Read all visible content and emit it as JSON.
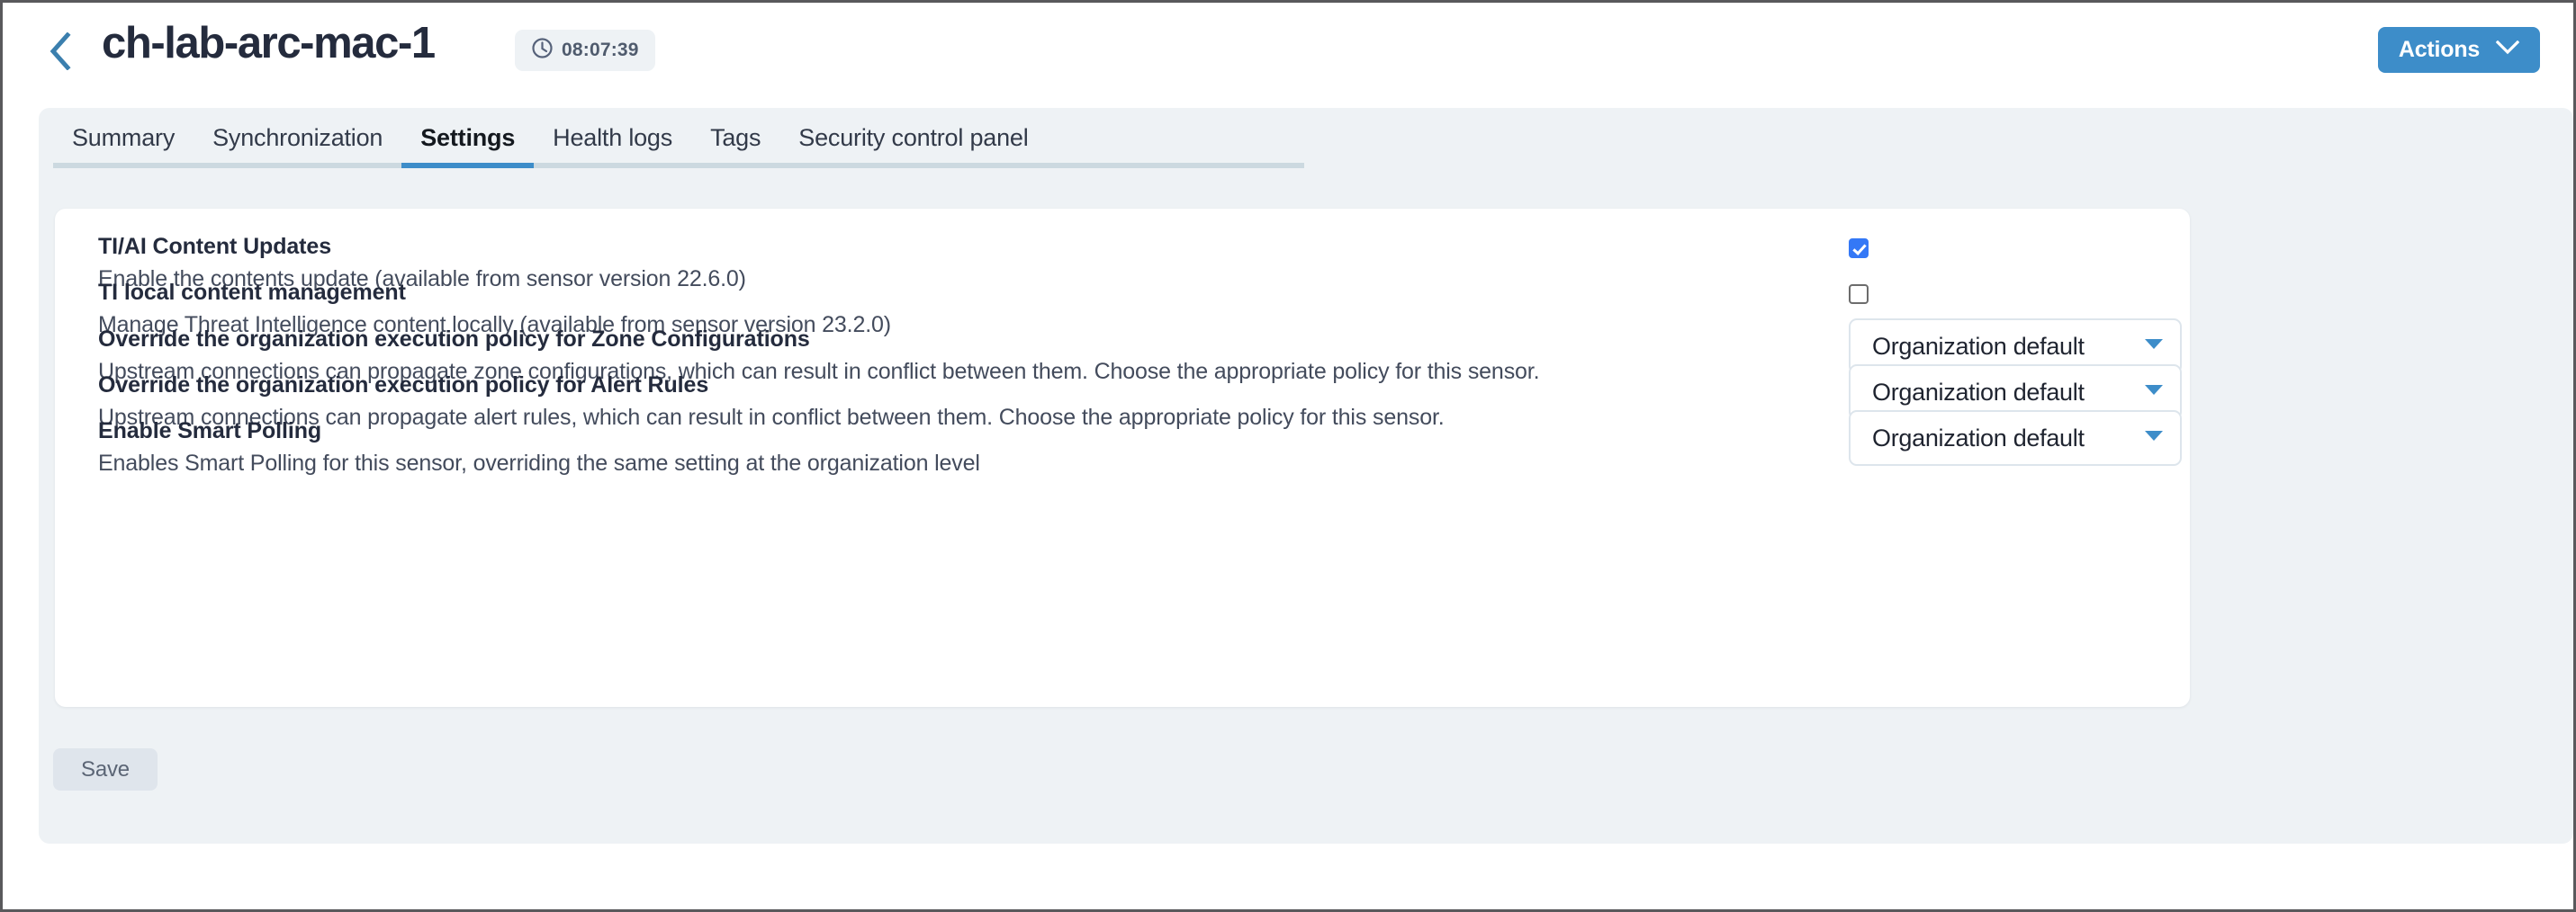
{
  "header": {
    "back_icon": "chevron-left-icon",
    "title": "ch-lab-arc-mac-1",
    "uptime_icon": "clock-icon",
    "uptime": "08:07:39",
    "actions_label": "Actions",
    "actions_caret_icon": "chevron-down-icon"
  },
  "tabs": [
    {
      "label": "Summary",
      "active": false
    },
    {
      "label": "Synchronization",
      "active": false
    },
    {
      "label": "Settings",
      "active": true
    },
    {
      "label": "Health logs",
      "active": false
    },
    {
      "label": "Tags",
      "active": false
    },
    {
      "label": "Security control panel",
      "active": false
    }
  ],
  "settings": [
    {
      "title": "TI/AI Content Updates",
      "description": "Enable the contents update (available from sensor version 22.6.0)",
      "control": "checkbox",
      "checked": true
    },
    {
      "title": "TI local content management",
      "description": "Manage Threat Intelligence content locally (available from sensor version 23.2.0)",
      "control": "checkbox",
      "checked": false
    },
    {
      "title": "Override the organization execution policy for Zone Configurations",
      "description": "Upstream connections can propagate zone configurations, which can result in conflict between them. Choose the appropriate policy for this sensor.",
      "control": "dropdown",
      "value": "Organization default"
    },
    {
      "title": "Override the organization execution policy for Alert Rules",
      "description": "Upstream connections can propagate alert rules, which can result in conflict between them. Choose the appropriate policy for this sensor.",
      "control": "dropdown",
      "value": "Organization default"
    },
    {
      "title": "Enable Smart Polling",
      "description": "Enables Smart Polling for this sensor, overriding the same setting at the organization level",
      "control": "dropdown",
      "value": "Organization default"
    }
  ],
  "footer": {
    "save_label": "Save"
  },
  "colors": {
    "accent": "#3d8dc9",
    "checkbox_checked": "#3478f6",
    "panel_bg": "#eef2f5",
    "card_bg": "#ffffff",
    "title_text": "#242b3d",
    "save_bg": "#dfe5ec"
  }
}
